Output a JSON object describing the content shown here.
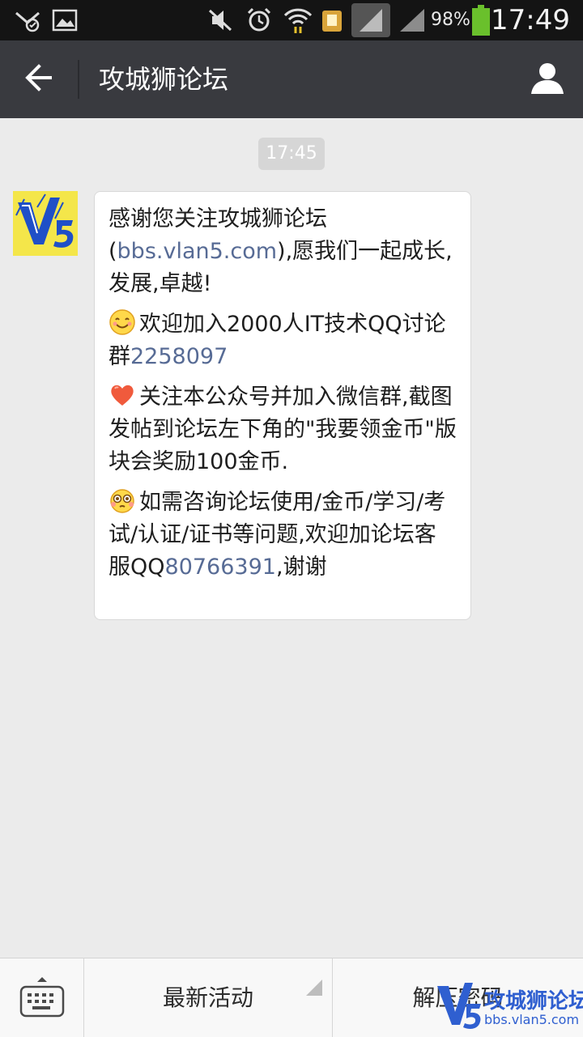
{
  "status_bar": {
    "battery_percent": "98%",
    "time": "17:49",
    "icons": [
      "missed-call-icon",
      "gallery-icon",
      "mute-icon",
      "alarm-icon",
      "wifi-icon",
      "app-icon",
      "signal-icon",
      "signal-icon-2",
      "battery-icon"
    ]
  },
  "header": {
    "title": "攻城狮论坛",
    "back_icon": "arrow-left-icon",
    "profile_icon": "person-icon"
  },
  "chat": {
    "timestamp": "17:45",
    "sender_avatar": "V5",
    "paragraphs": [
      {
        "before": "感谢您关注攻城狮论坛(",
        "link": "bbs.vlan5.com",
        "after": "),愿我们一起成长,发展,卓越!"
      },
      {
        "emoji": "smile-emoji-icon",
        "before": "欢迎加入2000人IT技术QQ讨论群",
        "link": "2258097",
        "after": ""
      },
      {
        "emoji": "heart-emoji-icon",
        "before": "关注本公众号并加入微信群,截图发帖到论坛左下角的\"我要领金币\"版块会奖励100金币.",
        "link": "",
        "after": ""
      },
      {
        "emoji": "blush-emoji-icon",
        "before": "如需咨询论坛使用/金币/学习/考试/认证/证书等问题,欢迎加论坛客服QQ",
        "link": "80766391",
        "after": ",谢谢"
      }
    ]
  },
  "bottom_menu": {
    "keyboard_icon": "keyboard-icon",
    "items": [
      {
        "label": "最新活动"
      },
      {
        "label": "解压密码"
      }
    ]
  },
  "watermark": {
    "title": "攻城狮论坛",
    "url": "bbs.vlan5.com"
  },
  "colors": {
    "header_bg": "#393a3f",
    "chat_bg": "#ebebeb",
    "link": "#576b95",
    "watermark": "#2f5fd0"
  }
}
